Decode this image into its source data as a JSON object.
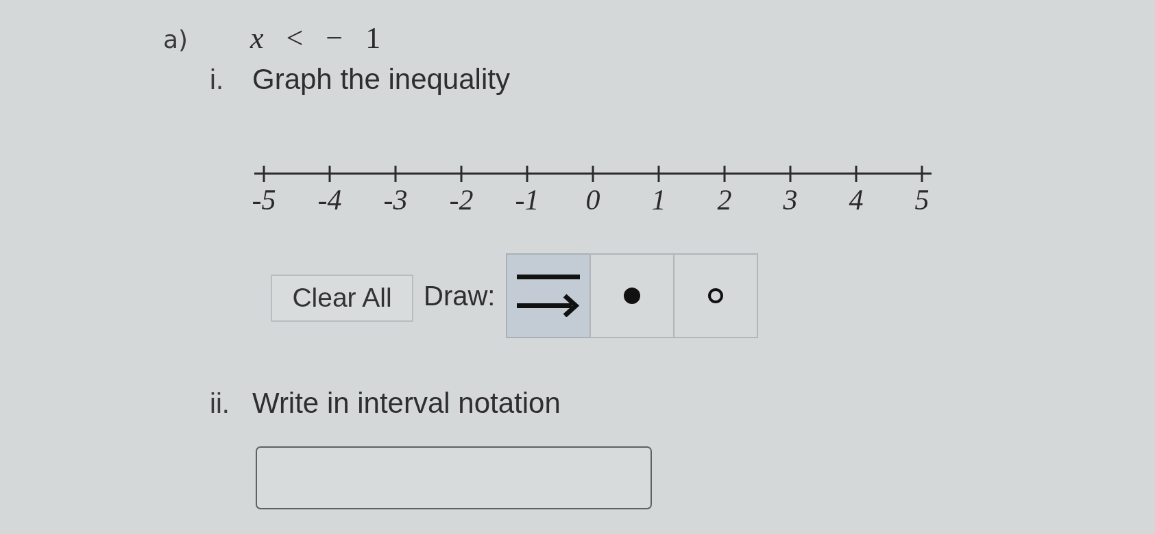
{
  "question": {
    "label": "a)",
    "expression": "*x* < − 1"
  },
  "part_i": {
    "label": "i.",
    "prompt": "Graph the inequality",
    "number_line": {
      "tick_labels": [
        "-5",
        "-4",
        "-3",
        "-2",
        "-1",
        "0",
        "1",
        "2",
        "3",
        "4",
        "5"
      ]
    },
    "toolbar": {
      "clear_button": "Clear All",
      "draw_label": "Draw:",
      "tools": [
        {
          "kind": "ray",
          "selected": true
        },
        {
          "kind": "closed-dot",
          "selected": false
        },
        {
          "kind": "open-dot",
          "selected": false
        }
      ]
    }
  },
  "part_ii": {
    "label": "ii.",
    "prompt": "Write in interval notation"
  }
}
